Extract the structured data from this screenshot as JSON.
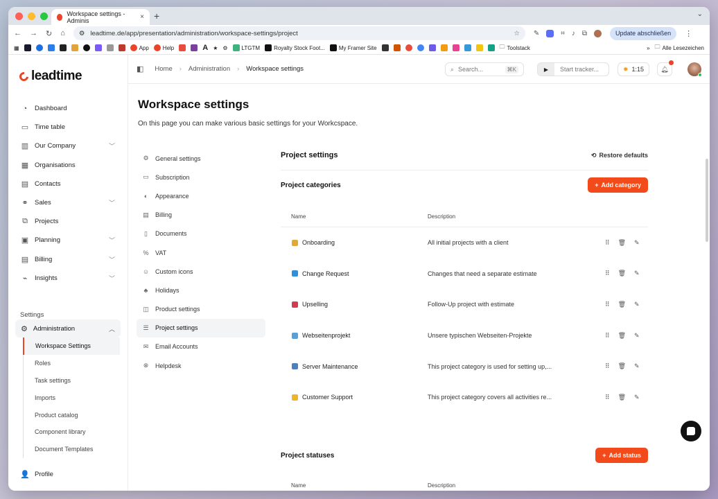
{
  "browser": {
    "tab_title": "Workspace settings - Adminis",
    "url": "leadtime.de/app/presentation/administration/workspace-settings/project",
    "update_label": "Update abschließen",
    "bookmarks": [
      "App",
      "Help",
      "LTGTM",
      "Royalty Stock Foot...",
      "My Framer Site",
      "Toolstack",
      "Alle Lesezeichen"
    ]
  },
  "logo": {
    "text": "leadtime"
  },
  "sidebar": {
    "items": [
      {
        "label": "Dashboard",
        "icon": "dashboard-icon"
      },
      {
        "label": "Time table",
        "icon": "calendar-icon"
      },
      {
        "label": "Our Company",
        "icon": "building-icon",
        "chevron": true
      },
      {
        "label": "Organisations",
        "icon": "organisations-icon"
      },
      {
        "label": "Contacts",
        "icon": "contacts-icon"
      },
      {
        "label": "Sales",
        "icon": "handshake-icon",
        "chevron": true
      },
      {
        "label": "Projects",
        "icon": "projects-icon"
      },
      {
        "label": "Planning",
        "icon": "planning-icon",
        "chevron": true
      },
      {
        "label": "Billing",
        "icon": "billing-icon",
        "chevron": true
      },
      {
        "label": "Insights",
        "icon": "insights-icon",
        "chevron": true
      }
    ],
    "settings_label": "Settings",
    "admin_label": "Administration",
    "sub_items": [
      "Workspace Settings",
      "Roles",
      "Task settings",
      "Imports",
      "Product catalog",
      "Component library",
      "Document Templates"
    ],
    "profile_label": "Profile"
  },
  "topbar": {
    "crumbs": [
      "Home",
      "Administration",
      "Workspace settings"
    ],
    "search_placeholder": "Search...",
    "search_kbd": "⌘K",
    "tracker_label": "Start tracker...",
    "timer": "1:15"
  },
  "page": {
    "title": "Workspace settings",
    "description": "On this page you can make various basic settings for your Workcspace."
  },
  "settings_nav": [
    {
      "label": "General settings",
      "icon": "gear-icon"
    },
    {
      "label": "Subscription",
      "icon": "card-icon"
    },
    {
      "label": "Appearance",
      "icon": "palette-icon"
    },
    {
      "label": "Billing",
      "icon": "billing-icon"
    },
    {
      "label": "Documents",
      "icon": "document-icon"
    },
    {
      "label": "VAT",
      "icon": "percent-icon"
    },
    {
      "label": "Custom icons",
      "icon": "smiley-icon"
    },
    {
      "label": "Holidays",
      "icon": "palm-icon"
    },
    {
      "label": "Product settings",
      "icon": "box-icon"
    },
    {
      "label": "Project settings",
      "icon": "list-icon",
      "active": true
    },
    {
      "label": "Email Accounts",
      "icon": "mail-icon"
    },
    {
      "label": "Helpdesk",
      "icon": "lifebuoy-icon"
    }
  ],
  "project_settings": {
    "title": "Project settings",
    "restore_label": "Restore defaults",
    "categories_title": "Project categories",
    "add_category_label": "Add category",
    "col_name": "Name",
    "col_description": "Description",
    "categories": [
      {
        "name": "Onboarding",
        "description": "All initial projects with a client",
        "color": "#e0a93a"
      },
      {
        "name": "Change Request",
        "description": "Changes that need a separate estimate",
        "color": "#2f8fd8"
      },
      {
        "name": "Upselling",
        "description": "Follow-Up project with estimate",
        "color": "#d23c4e"
      },
      {
        "name": "Webseitenprojekt",
        "description": "Unsere typischen Webseiten-Projekte",
        "color": "#5aa0d8"
      },
      {
        "name": "Server Maintenance",
        "description": "This project category is used for setting up,...",
        "color": "#4d7fbf"
      },
      {
        "name": "Customer Support",
        "description": "This project category covers all activities re...",
        "color": "#f0b429"
      }
    ],
    "statuses_title": "Project statuses",
    "add_status_label": "Add status"
  }
}
